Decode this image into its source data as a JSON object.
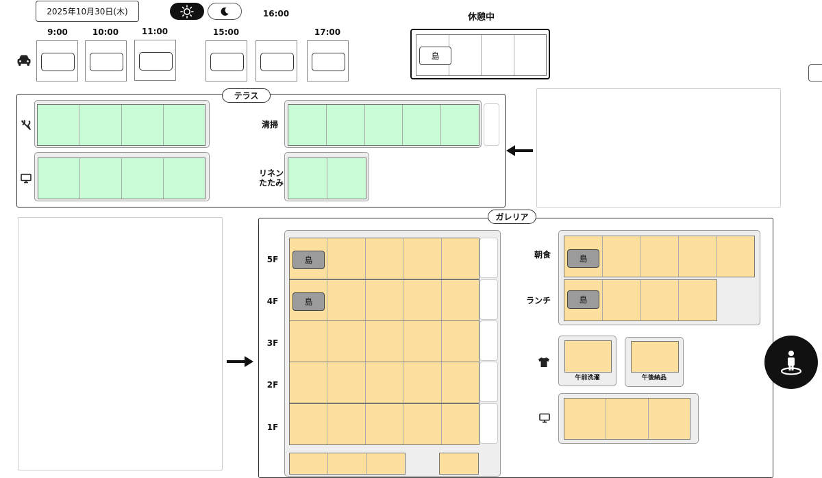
{
  "header": {
    "date": "2025年10月30日(木)",
    "light_mode_icon": "sun-icon",
    "dark_mode_icon": "moon-icon",
    "vehicle_icon": "car-icon"
  },
  "schedule": {
    "slots": [
      {
        "time": "9:00"
      },
      {
        "time": "10:00"
      },
      {
        "time": "11:00"
      },
      {
        "time": "15:00"
      },
      {
        "time": "16:00"
      },
      {
        "time": "17:00"
      }
    ]
  },
  "break": {
    "title": "休憩中",
    "tag": "島"
  },
  "terrace": {
    "title": "テラス",
    "rows": {
      "cleaning": "清掃",
      "linen_1": "リネン",
      "linen_2": "たたみ"
    },
    "icons": [
      "fork-knife-icon",
      "monitor-icon"
    ]
  },
  "galleria": {
    "title": "ガレリア",
    "floors": [
      "5F",
      "4F",
      "3F",
      "2F",
      "1F"
    ],
    "floor_tags": {
      "5F": "島",
      "4F": "島"
    },
    "meals": {
      "breakfast": "朝食",
      "lunch": "ランチ",
      "breakfast_tag": "島",
      "lunch_tag": "島"
    },
    "laundry": {
      "morning": "午前洗濯",
      "afternoon": "午後納品"
    },
    "icons": [
      "shirt-icon",
      "monitor-icon"
    ]
  },
  "fab": {
    "icon": "person-location-icon"
  },
  "colors": {
    "green_cell": "#c7fcd5",
    "orange_cell": "#fde09d",
    "tag_gray": "#9b9b9b",
    "dark": "#111111"
  }
}
